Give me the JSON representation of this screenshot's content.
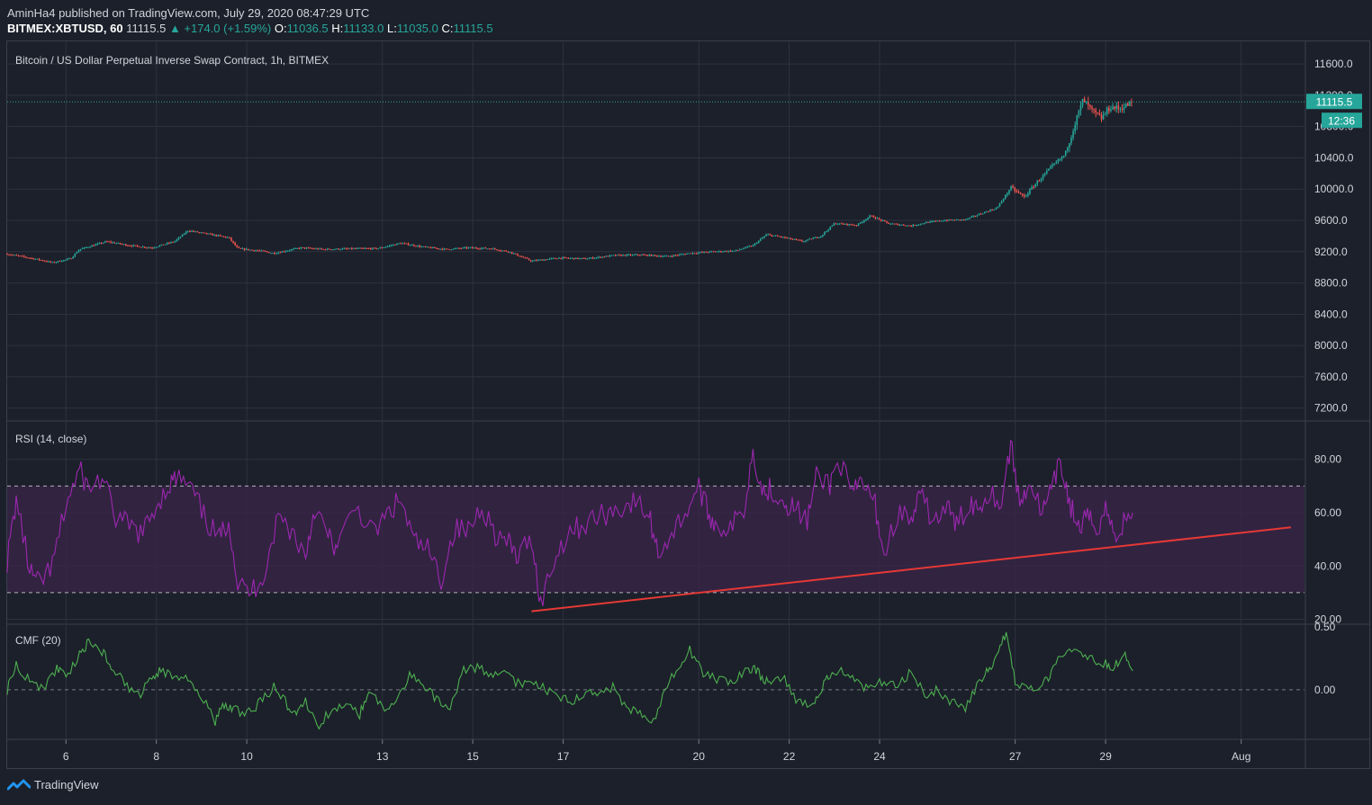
{
  "header": {
    "publisher_line": "AminHa4 published on TradingView.com, July 29, 2020 08:47:29 UTC",
    "symbol": "BITMEX:XBTUSD, 60",
    "last": "11115.5",
    "change": "▲ +174.0 (+1.59%)",
    "o_label": "O:",
    "o_value": "11036.5",
    "h_label": "H:",
    "h_value": "11133.0",
    "l_label": "L:",
    "l_value": "11035.0",
    "c_label": "C:",
    "c_value": "11115.5"
  },
  "panes": {
    "price_title": "Bitcoin / US Dollar Perpetual Inverse Swap Contract, 1h, BITMEX",
    "rsi_title": "RSI (14, close)",
    "cmf_title": "CMF (20)"
  },
  "price_badge": {
    "value": "11115.5",
    "countdown": "12:36"
  },
  "footer": {
    "brand": "TradingView"
  },
  "colors": {
    "background": "#1c202a",
    "grid": "#2e3240",
    "up": "#26a69a",
    "down": "#ef5350",
    "rsi": "#9c27b0",
    "rsi_band": "#3a2449",
    "trendline": "#e53935",
    "cmf": "#4caf50"
  },
  "chart_data": [
    {
      "type": "candlestick",
      "title": "Bitcoin / US Dollar Perpetual Inverse Swap Contract, 1h, BITMEX",
      "x_ticks": [
        "6",
        "8",
        "10",
        "13",
        "15",
        "17",
        "20",
        "22",
        "24",
        "27",
        "29",
        "Aug"
      ],
      "x_tick_days": [
        6,
        8,
        10,
        13,
        15,
        17,
        20,
        22,
        24,
        27,
        29,
        32
      ],
      "x_range_days": [
        4.7,
        33.4
      ],
      "y_ticks": [
        11600,
        11200,
        10800,
        10400,
        10000,
        9600,
        9200,
        8800,
        8400,
        8000,
        7600,
        7200
      ],
      "y_tick_labels": [
        "11600.0",
        "11200.0",
        "10800.0",
        "10400.0",
        "10000.0",
        "9600.0",
        "9200.0",
        "8800.0",
        "8400.0",
        "8000.0",
        "7600.0",
        "7200.0"
      ],
      "ylim": [
        7070,
        11820
      ],
      "last_price": 11115.5,
      "close_path": [
        [
          4.7,
          9170
        ],
        [
          5.3,
          9110
        ],
        [
          5.7,
          9060
        ],
        [
          6.1,
          9110
        ],
        [
          6.3,
          9230
        ],
        [
          6.9,
          9330
        ],
        [
          7.4,
          9280
        ],
        [
          7.9,
          9250
        ],
        [
          8.4,
          9330
        ],
        [
          8.7,
          9470
        ],
        [
          9.2,
          9420
        ],
        [
          9.6,
          9380
        ],
        [
          9.8,
          9240
        ],
        [
          10.3,
          9210
        ],
        [
          10.6,
          9180
        ],
        [
          11.2,
          9250
        ],
        [
          11.7,
          9230
        ],
        [
          12.5,
          9240
        ],
        [
          12.9,
          9240
        ],
        [
          13.4,
          9310
        ],
        [
          13.9,
          9260
        ],
        [
          14.4,
          9230
        ],
        [
          14.9,
          9250
        ],
        [
          15.4,
          9240
        ],
        [
          15.8,
          9200
        ],
        [
          16.3,
          9080
        ],
        [
          16.9,
          9120
        ],
        [
          17.5,
          9110
        ],
        [
          18.1,
          9150
        ],
        [
          18.7,
          9160
        ],
        [
          19.3,
          9140
        ],
        [
          19.8,
          9180
        ],
        [
          20.3,
          9200
        ],
        [
          20.8,
          9210
        ],
        [
          21.2,
          9280
        ],
        [
          21.5,
          9420
        ],
        [
          21.9,
          9380
        ],
        [
          22.3,
          9330
        ],
        [
          22.7,
          9400
        ],
        [
          23.0,
          9560
        ],
        [
          23.5,
          9540
        ],
        [
          23.8,
          9660
        ],
        [
          24.2,
          9560
        ],
        [
          24.7,
          9530
        ],
        [
          25.0,
          9570
        ],
        [
          25.4,
          9600
        ],
        [
          25.9,
          9610
        ],
        [
          26.3,
          9700
        ],
        [
          26.6,
          9760
        ],
        [
          26.9,
          10020
        ],
        [
          27.2,
          9900
        ],
        [
          27.5,
          10100
        ],
        [
          27.8,
          10280
        ],
        [
          28.1,
          10440
        ],
        [
          28.3,
          10800
        ],
        [
          28.5,
          11140
        ],
        [
          28.7,
          11000
        ],
        [
          28.9,
          10900
        ],
        [
          29.1,
          11050
        ],
        [
          29.3,
          11030
        ],
        [
          29.5,
          11080
        ],
        [
          29.6,
          11115
        ]
      ]
    },
    {
      "type": "line",
      "title": "RSI (14, close)",
      "y_ticks": [
        80,
        60,
        40,
        20
      ],
      "y_tick_labels": [
        "80.00",
        "60.00",
        "40.00",
        "20.00"
      ],
      "ylim": [
        19.5,
        87
      ],
      "overbought": 70,
      "oversold": 30,
      "series": [
        {
          "x": [
            4.7,
            4.9,
            5.2,
            5.4,
            5.7,
            6.0,
            6.3,
            6.5,
            6.8,
            7.1,
            7.4,
            7.7,
            8.0,
            8.3,
            8.5,
            8.8,
            9.1,
            9.4,
            9.6,
            9.8,
            10.1,
            10.4,
            10.7,
            11.0,
            11.3,
            11.5,
            11.8,
            12.0,
            12.4,
            12.8,
            13.1,
            13.4,
            13.7,
            14.0,
            14.3,
            14.6,
            14.9,
            15.2,
            15.5,
            15.8,
            16.0,
            16.3,
            16.5,
            16.8,
            17.1,
            17.4,
            17.7,
            18.0,
            18.3,
            18.6,
            18.9,
            19.1,
            19.4,
            19.7,
            20.0,
            20.2,
            20.4,
            20.7,
            21.0,
            21.2,
            21.4,
            21.6,
            21.9,
            22.1,
            22.4,
            22.6,
            22.9,
            23.1,
            23.4,
            23.6,
            23.9,
            24.1,
            24.4,
            24.7,
            24.9,
            25.2,
            25.5,
            25.7,
            26.0,
            26.2,
            26.4,
            26.7,
            26.9,
            27.1,
            27.3,
            27.6,
            27.8,
            28.0,
            28.2,
            28.4,
            28.6,
            28.8,
            29.0,
            29.2,
            29.4,
            29.6
          ],
          "values": [
            42,
            65,
            38,
            33,
            40,
            63,
            76,
            69,
            73,
            58,
            55,
            52,
            63,
            71,
            73,
            68,
            57,
            50,
            58,
            33,
            30,
            38,
            59,
            53,
            44,
            62,
            51,
            46,
            63,
            52,
            59,
            65,
            49,
            46,
            35,
            54,
            53,
            63,
            52,
            48,
            43,
            51,
            26,
            42,
            53,
            55,
            58,
            60,
            62,
            64,
            59,
            45,
            52,
            60,
            70,
            60,
            55,
            54,
            61,
            84,
            68,
            69,
            64,
            62,
            57,
            73,
            71,
            80,
            66,
            72,
            63,
            44,
            60,
            57,
            66,
            57,
            62,
            55,
            64,
            62,
            68,
            64,
            86,
            63,
            72,
            60,
            68,
            79,
            64,
            54,
            58,
            54,
            62,
            51,
            56,
            60
          ]
        }
      ],
      "trendline": {
        "x": [
          16.3,
          33.1
        ],
        "y": [
          23,
          54.5
        ]
      }
    },
    {
      "type": "line",
      "title": "CMF (20)",
      "y_ticks": [
        0.5,
        0
      ],
      "y_tick_labels": [
        "0.50",
        "0.00"
      ],
      "ylim": [
        -0.38,
        0.5
      ],
      "series": [
        {
          "x": [
            4.7,
            4.9,
            5.2,
            5.5,
            5.8,
            6.0,
            6.3,
            6.5,
            6.8,
            7.0,
            7.3,
            7.6,
            7.9,
            8.1,
            8.4,
            8.7,
            9.0,
            9.3,
            9.5,
            9.7,
            10.0,
            10.3,
            10.6,
            10.9,
            11.1,
            11.3,
            11.6,
            11.9,
            12.2,
            12.5,
            12.7,
            13.0,
            13.3,
            13.6,
            13.9,
            14.2,
            14.5,
            14.8,
            15.1,
            15.4,
            15.7,
            16.0,
            16.3,
            16.6,
            16.9,
            17.2,
            17.5,
            17.8,
            18.1,
            18.4,
            18.7,
            19.0,
            19.3,
            19.6,
            19.8,
            20.1,
            20.4,
            20.7,
            21.0,
            21.2,
            21.4,
            21.6,
            21.9,
            22.2,
            22.5,
            22.7,
            22.9,
            23.2,
            23.5,
            23.8,
            24.1,
            24.4,
            24.7,
            25.0,
            25.3,
            25.6,
            25.9,
            26.2,
            26.4,
            26.6,
            26.8,
            27.0,
            27.3,
            27.6,
            27.8,
            28.1,
            28.4,
            28.7,
            29.0,
            29.2,
            29.4,
            29.6
          ],
          "values": [
            0.0,
            0.2,
            0.07,
            0.0,
            0.18,
            0.1,
            0.28,
            0.38,
            0.3,
            0.2,
            0.05,
            -0.05,
            0.1,
            0.15,
            0.12,
            0.08,
            -0.05,
            -0.25,
            -0.12,
            -0.15,
            -0.2,
            -0.1,
            0.02,
            -0.12,
            -0.2,
            -0.1,
            -0.28,
            -0.15,
            -0.1,
            -0.2,
            0.0,
            -0.15,
            -0.1,
            0.12,
            0.05,
            -0.08,
            -0.12,
            0.15,
            0.18,
            0.1,
            0.12,
            0.05,
            0.08,
            0.0,
            -0.05,
            -0.08,
            -0.05,
            0.0,
            0.02,
            -0.15,
            -0.2,
            -0.25,
            0.05,
            0.18,
            0.32,
            0.13,
            0.08,
            0.05,
            0.15,
            0.18,
            0.1,
            0.05,
            0.08,
            -0.1,
            -0.12,
            0.0,
            0.12,
            0.15,
            0.05,
            0.0,
            0.08,
            0.02,
            0.15,
            -0.05,
            0.0,
            -0.1,
            -0.15,
            0.05,
            0.15,
            0.25,
            0.46,
            0.05,
            0.0,
            0.02,
            0.15,
            0.3,
            0.28,
            0.25,
            0.2,
            0.18,
            0.3,
            0.15
          ]
        }
      ]
    }
  ],
  "labels": {
    "price_grid_label": "price-grid-line",
    "close_line": "close-price-line"
  }
}
